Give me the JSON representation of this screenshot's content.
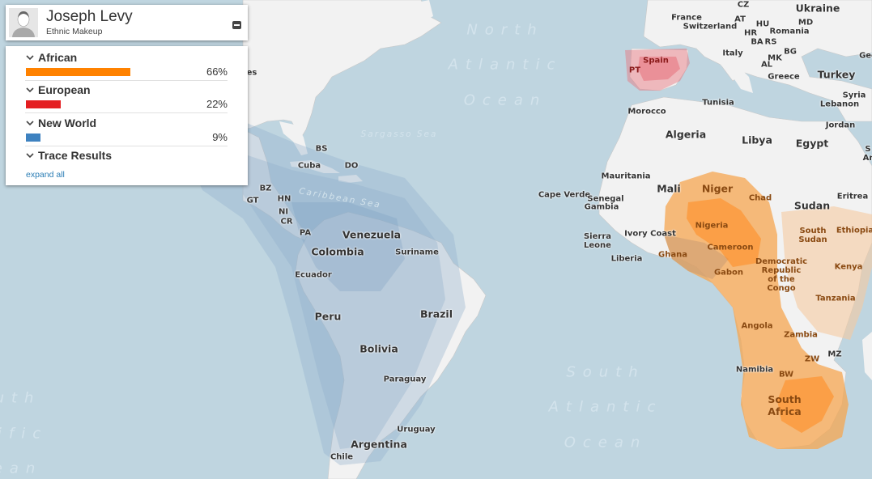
{
  "profile": {
    "name": "Joseph Levy",
    "subtitle": "Ethnic Makeup",
    "avatar_icon": "user-silhouette-icon",
    "collapse_icon": "minus-square-icon"
  },
  "sections": [
    {
      "label": "African",
      "percent": 66,
      "percent_label": "66%",
      "color": "#ff8200"
    },
    {
      "label": "European",
      "percent": 22,
      "percent_label": "22%",
      "color": "#e41e21"
    },
    {
      "label": "New World",
      "percent": 9,
      "percent_label": "9%",
      "color": "#3e82c0"
    },
    {
      "label": "Trace Results"
    }
  ],
  "expand_all_label": "expand all",
  "map": {
    "colors": {
      "ocean": "#bfd5e0",
      "land": "#f2f2f2",
      "african_region": "#f5a650",
      "european_region": "#e8707a",
      "new_world_region": "#8fb0cc"
    },
    "ocean_labels": [
      {
        "id": "north-atlantic",
        "lines": [
          "North",
          "Atlantic",
          "Ocean"
        ]
      },
      {
        "id": "south-atlantic",
        "lines": [
          "South",
          "Atlantic",
          "Ocean"
        ]
      },
      {
        "id": "south-pacific",
        "lines": [
          "uth",
          "ific",
          "ean"
        ]
      }
    ],
    "sea_labels": [
      "Sargasso Sea",
      "Caribbean Sea"
    ],
    "country_labels": {
      "europe": [
        "CZ",
        "Ukraine",
        "France",
        "Switzerland",
        "AT",
        "HU",
        "MD",
        "HR",
        "Romania",
        "BA",
        "RS",
        "Italy",
        "BG",
        "MK",
        "AL",
        "Greece",
        "Turkey",
        "Geo",
        "Syria",
        "Lebanon",
        "Jordan",
        "Spain",
        "PT"
      ],
      "africa": [
        "Morocco",
        "Tunisia",
        "Algeria",
        "Libya",
        "Egypt",
        "Mauritania",
        "Mali",
        "Niger",
        "Chad",
        "Sudan",
        "Eritrea",
        "Cape Verde",
        "Senegal",
        "Gambia",
        "Nigeria",
        "South Sudan",
        "Ethiopia",
        "Sierra Leone",
        "Ivory Coast",
        "Liberia",
        "Ghana",
        "Cameroon",
        "Gabon",
        "Democratic Republic of the Congo",
        "Kenya",
        "Tanzania",
        "Angola",
        "Zambia",
        "MZ",
        "ZW",
        "Namibia",
        "BW",
        "South Africa",
        "S Ar"
      ],
      "americas": [
        "es",
        "BS",
        "Cuba",
        "DO",
        "BZ",
        "GT",
        "HN",
        "NI",
        "CR",
        "PA",
        "Venezuela",
        "Colombia",
        "Suriname",
        "Ecuador",
        "Peru",
        "Brazil",
        "Bolivia",
        "Paraguay",
        "Uruguay",
        "Argentina",
        "Chile"
      ]
    }
  }
}
